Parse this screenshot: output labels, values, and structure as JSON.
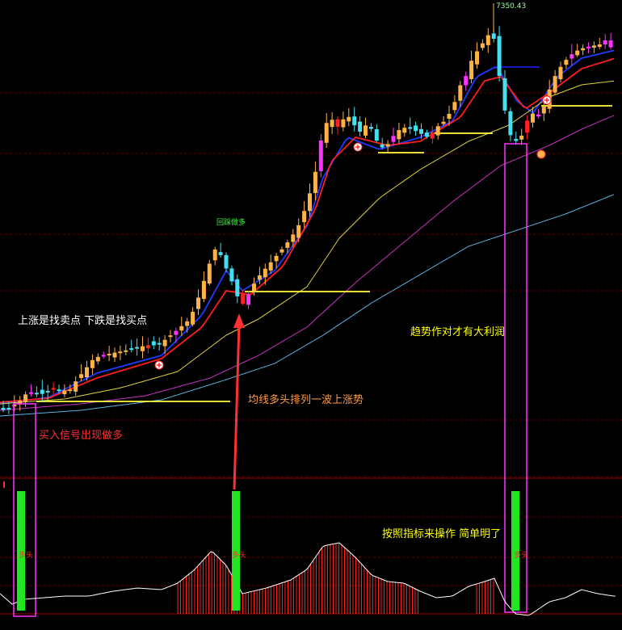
{
  "annotations": {
    "sell_buy_rule": "上涨是找卖点    下跌是找买点",
    "trend_profit": "趋势作对才有大利润",
    "ma_bull_alignment": "均线多头排列一波上涨势",
    "buy_signal": "买入信号出现做多",
    "follow_indicator": "按照指标来操作  简单明了"
  },
  "tags": {
    "peak_price": "7350.43",
    "pullback_buy": "回踩做多",
    "long_label": "多头"
  },
  "colors": {
    "background": "#000000",
    "up_candle": "#ffb347",
    "down_candle": "#44e0f0",
    "pink_candle": "#ff33ff",
    "red_candle": "#ff2020",
    "ma_fast_blue": "#1e3cff",
    "ma_red": "#ff1e1e",
    "ma_yellow": "#e0d23c",
    "ma_purple": "#c832c8",
    "ma_skyblue": "#5ab4e6",
    "support_line": "#ffff40",
    "signal_bar": "#22e622",
    "highlight_box": "#ff33ff",
    "arrow": "#ff3030",
    "oscillator": "#ffffff",
    "oscillator_hist": "#ff2020",
    "grid": "#5a0000"
  },
  "chart_data": {
    "type": "candlestick",
    "y_range": [
      5400,
      7400
    ],
    "candles_count": 110,
    "note": ""
  }
}
